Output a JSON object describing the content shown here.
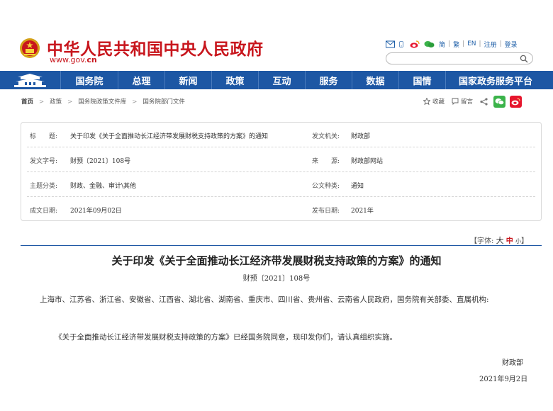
{
  "header": {
    "site_title": "中华人民共和国中央人民政府",
    "site_domain_prefix": "www.gov.",
    "site_domain_cn": "cn",
    "links": [
      "简",
      "繁",
      "EN",
      "注册",
      "登录"
    ],
    "icons": [
      "mail-icon",
      "mobile-icon",
      "weibo-icon",
      "wechat-icon"
    ],
    "search_placeholder": ""
  },
  "nav": {
    "items": [
      "国务院",
      "总理",
      "新闻",
      "政策",
      "互动",
      "服务",
      "数据",
      "国情",
      "国家政务服务平台"
    ]
  },
  "breadcrumb": [
    "首页",
    "政策",
    "国务院政策文件库",
    "国务院部门文件"
  ],
  "actions": {
    "favorite": "收藏",
    "comment": "留言"
  },
  "meta": {
    "title_key": "标　　题:",
    "title_val": "关于印发《关于全面推动长江经济带发展财税支持政策的方案》的通知",
    "issuer_key": "发文机关:",
    "issuer_val": "财政部",
    "docno_key": "发文字号:",
    "docno_val": "财预〔2021〕108号",
    "source_key": "来　　源:",
    "source_val": "财政部网站",
    "topic_key": "主题分类:",
    "topic_val": "财政、金融、审计\\其他",
    "type_key": "公文种类:",
    "type_val": "通知",
    "written_key": "成文日期:",
    "written_val": "2021年09月02日",
    "published_key": "发布日期:",
    "published_val": "2021年"
  },
  "fontsize": {
    "label": "【字体:",
    "big": "大",
    "mid": "中",
    "small": "小",
    "end": "】"
  },
  "doc": {
    "title": "关于印发《关于全面推动长江经济带发展财税支持政策的方案》的通知",
    "number": "财预〔2021〕108号",
    "salutation": "上海市、江苏省、浙江省、安徽省、江西省、湖北省、湖南省、重庆市、四川省、贵州省、云南省人民政府，国务院有关部委、直属机构:",
    "body": "《关于全面推动长江经济带发展财税支持政策的方案》已经国务院同意，现印发你们，请认真组织实施。",
    "signer": "财政部",
    "date": "2021年9月2日"
  },
  "colors": {
    "brand_red": "#c8161d",
    "nav_blue": "#1d57a4",
    "wechat_green": "#3bb34a",
    "weibo_red": "#e6162d"
  }
}
